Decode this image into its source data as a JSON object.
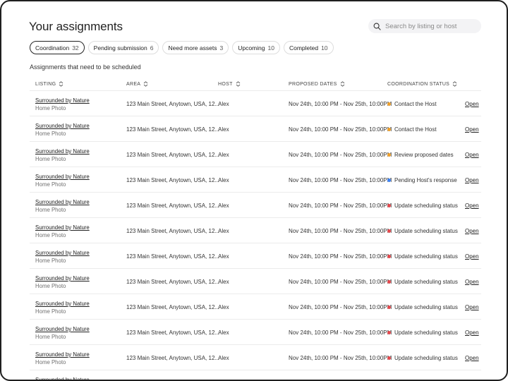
{
  "page": {
    "title": "Your assignments",
    "subtitle": "Assignments that need to be scheduled"
  },
  "search": {
    "placeholder": "Search by listing or host",
    "value": ""
  },
  "tabs": [
    {
      "label": "Coordination",
      "count": "32",
      "active": true
    },
    {
      "label": "Pending submission",
      "count": "6",
      "active": false
    },
    {
      "label": "Need more assets",
      "count": "3",
      "active": false
    },
    {
      "label": "Upcoming",
      "count": "10",
      "active": false
    },
    {
      "label": "Completed",
      "count": "10",
      "active": false
    }
  ],
  "columns": [
    "LISTING",
    "AREA",
    "HOST",
    "PROPOSED DATES",
    "COORDINATION STATUS"
  ],
  "colors": {
    "orange": "#f0a02a",
    "blue": "#3b82f6",
    "red": "#e5484d"
  },
  "rows": [
    {
      "listing": "Surrounded by Nature",
      "type": "Home Photo",
      "area": "123 Main Street, Anytown, USA, 12...",
      "host": "Alex",
      "dates": "Nov 24th, 10:00 PM - Nov 25th, 10:00PM",
      "status": "Contact the Host",
      "status_color": "#f0a02a",
      "action": "Open"
    },
    {
      "listing": "Surrounded by Nature",
      "type": "Home Photo",
      "area": "123 Main Street, Anytown, USA, 12...",
      "host": "Alex",
      "dates": "Nov 24th, 10:00 PM - Nov 25th, 10:00PM",
      "status": "Contact the Host",
      "status_color": "#f0a02a",
      "action": "Open"
    },
    {
      "listing": "Surrounded by Nature",
      "type": "Home Photo",
      "area": "123 Main Street, Anytown, USA, 12...",
      "host": "Alex",
      "dates": "Nov 24th, 10:00 PM - Nov 25th, 10:00PM",
      "status": "Review proposed dates",
      "status_color": "#f0a02a",
      "action": "Open"
    },
    {
      "listing": "Surrounded by Nature",
      "type": "Home Photo",
      "area": "123 Main Street, Anytown, USA, 12...",
      "host": "Alex",
      "dates": "Nov 24th, 10:00 PM - Nov 25th, 10:00PM",
      "status": "Pending Host's response",
      "status_color": "#3b82f6",
      "action": "Open"
    },
    {
      "listing": "Surrounded by Nature",
      "type": "Home Photo",
      "area": "123 Main Street, Anytown, USA, 12...",
      "host": "Alex",
      "dates": "Nov 24th, 10:00 PM - Nov 25th, 10:00PM",
      "status": "Update scheduling status",
      "status_color": "#e5484d",
      "action": "Open"
    },
    {
      "listing": "Surrounded by Nature",
      "type": "Home Photo",
      "area": "123 Main Street, Anytown, USA, 12...",
      "host": "Alex",
      "dates": "Nov 24th, 10:00 PM - Nov 25th, 10:00PM",
      "status": "Update scheduling status",
      "status_color": "#e5484d",
      "action": "Open"
    },
    {
      "listing": "Surrounded by Nature",
      "type": "Home Photo",
      "area": "123 Main Street, Anytown, USA, 12...",
      "host": "Alex",
      "dates": "Nov 24th, 10:00 PM - Nov 25th, 10:00PM",
      "status": "Update scheduling status",
      "status_color": "#e5484d",
      "action": "Open"
    },
    {
      "listing": "Surrounded by Nature",
      "type": "Home Photo",
      "area": "123 Main Street, Anytown, USA, 12...",
      "host": "Alex",
      "dates": "Nov 24th, 10:00 PM - Nov 25th, 10:00PM",
      "status": "Update scheduling status",
      "status_color": "#e5484d",
      "action": "Open"
    },
    {
      "listing": "Surrounded by Nature",
      "type": "Home Photo",
      "area": "123 Main Street, Anytown, USA, 12...",
      "host": "Alex",
      "dates": "Nov 24th, 10:00 PM - Nov 25th, 10:00PM",
      "status": "Update scheduling status",
      "status_color": "#e5484d",
      "action": "Open"
    },
    {
      "listing": "Surrounded by Nature",
      "type": "Home Photo",
      "area": "123 Main Street, Anytown, USA, 12...",
      "host": "Alex",
      "dates": "Nov 24th, 10:00 PM - Nov 25th, 10:00PM",
      "status": "Update scheduling status",
      "status_color": "#e5484d",
      "action": "Open"
    },
    {
      "listing": "Surrounded by Nature",
      "type": "Home Photo",
      "area": "123 Main Street, Anytown, USA, 12...",
      "host": "Alex",
      "dates": "Nov 24th, 10:00 PM - Nov 25th, 10:00PM",
      "status": "Update scheduling status",
      "status_color": "#e5484d",
      "action": "Open"
    },
    {
      "listing": "Surrounded by Nature",
      "type": "",
      "area": "",
      "host": "",
      "dates": "",
      "status": "",
      "status_color": "",
      "action": ""
    }
  ]
}
